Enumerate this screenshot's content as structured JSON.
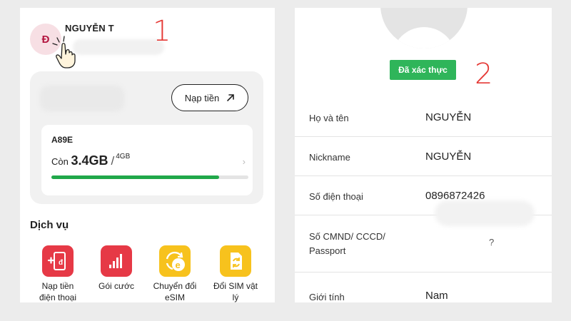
{
  "left_panel": {
    "user": {
      "initial": "Đ",
      "name": "NGUYỄN T"
    },
    "step_label": "1",
    "top_up_label": "Nạp tiền",
    "plan": {
      "code": "A89E",
      "remaining_prefix": "Còn",
      "remaining_value": "3.4GB",
      "total": "4GB",
      "usage_fraction": 0.85
    },
    "services_title": "Dịch vụ",
    "services": [
      {
        "label_line1": "Nạp tiền",
        "label_line2": "điện thoại",
        "icon": "phone-topup-icon",
        "color": "#e63946"
      },
      {
        "label_line1": "Gói cước",
        "label_line2": "",
        "icon": "signal-bars-icon",
        "color": "#e63946"
      },
      {
        "label_line1": "Chuyển đổi",
        "label_line2": "eSIM",
        "icon": "esim-convert-icon",
        "color": "#f7c21d"
      },
      {
        "label_line1": "Đổi SIM vật",
        "label_line2": "lý",
        "icon": "sim-swap-icon",
        "color": "#f7c21d"
      }
    ]
  },
  "right_panel": {
    "step_label": "2",
    "verified_badge": "Đã xác thực",
    "fields": [
      {
        "label": "Họ và tên",
        "value": "NGUYỄN"
      },
      {
        "label": "Nickname",
        "value": "NGUYỄN"
      },
      {
        "label": "Số điện thoại",
        "value": "0896872426"
      },
      {
        "label": "Số CMND/ CCCD/ Passport",
        "value": "?"
      },
      {
        "label": "Giới tính",
        "value": "Nam"
      }
    ]
  },
  "colors": {
    "accent_red": "#e53935",
    "progress_green": "#21a84a",
    "verified_green": "#2fb55a"
  }
}
